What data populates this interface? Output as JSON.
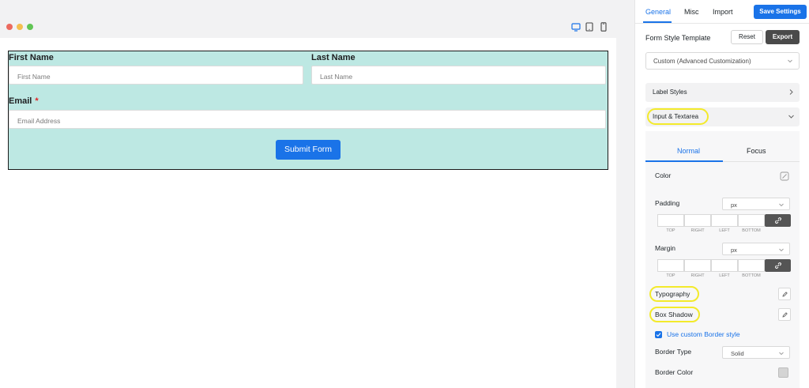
{
  "form": {
    "first_name_label": "First Name",
    "first_name_placeholder": "First Name",
    "last_name_label": "Last Name",
    "last_name_placeholder": "Last Name",
    "email_label": "Email",
    "email_required_mark": "*",
    "email_placeholder": "Email Address",
    "submit_label": "Submit Form",
    "background_color": "#bde8e3"
  },
  "device_icons": [
    "desktop-icon",
    "tablet-icon",
    "mobile-icon"
  ],
  "sidebar": {
    "tabs": [
      {
        "label": "General",
        "active": true
      },
      {
        "label": "Misc",
        "active": false
      },
      {
        "label": "Import",
        "active": false
      }
    ],
    "save_label": "Save Settings",
    "template_label": "Form Style Template",
    "reset_label": "Reset",
    "export_label": "Export",
    "template_value": "Custom (Advanced Customization)",
    "sections": {
      "label_styles": "Label Styles",
      "input_textarea": "Input & Textarea"
    },
    "subtabs": {
      "normal": "Normal",
      "focus": "Focus"
    },
    "color_label": "Color",
    "padding_label": "Padding",
    "padding_unit": "px",
    "margin_label": "Margin",
    "margin_unit": "px",
    "box_captions": {
      "top": "TOP",
      "right": "RIGHT",
      "left": "LEFT",
      "bottom": "BOTTOM"
    },
    "typography_label": "Typography",
    "box_shadow_label": "Box Shadow",
    "custom_border_label": "Use custom Border style",
    "border_type_label": "Border Type",
    "border_type_value": "Solid",
    "border_color_label": "Border Color"
  },
  "colors": {
    "accent": "#1a73e8",
    "highlight": "#f3ea2b",
    "export_button": "#4a4a4a"
  }
}
